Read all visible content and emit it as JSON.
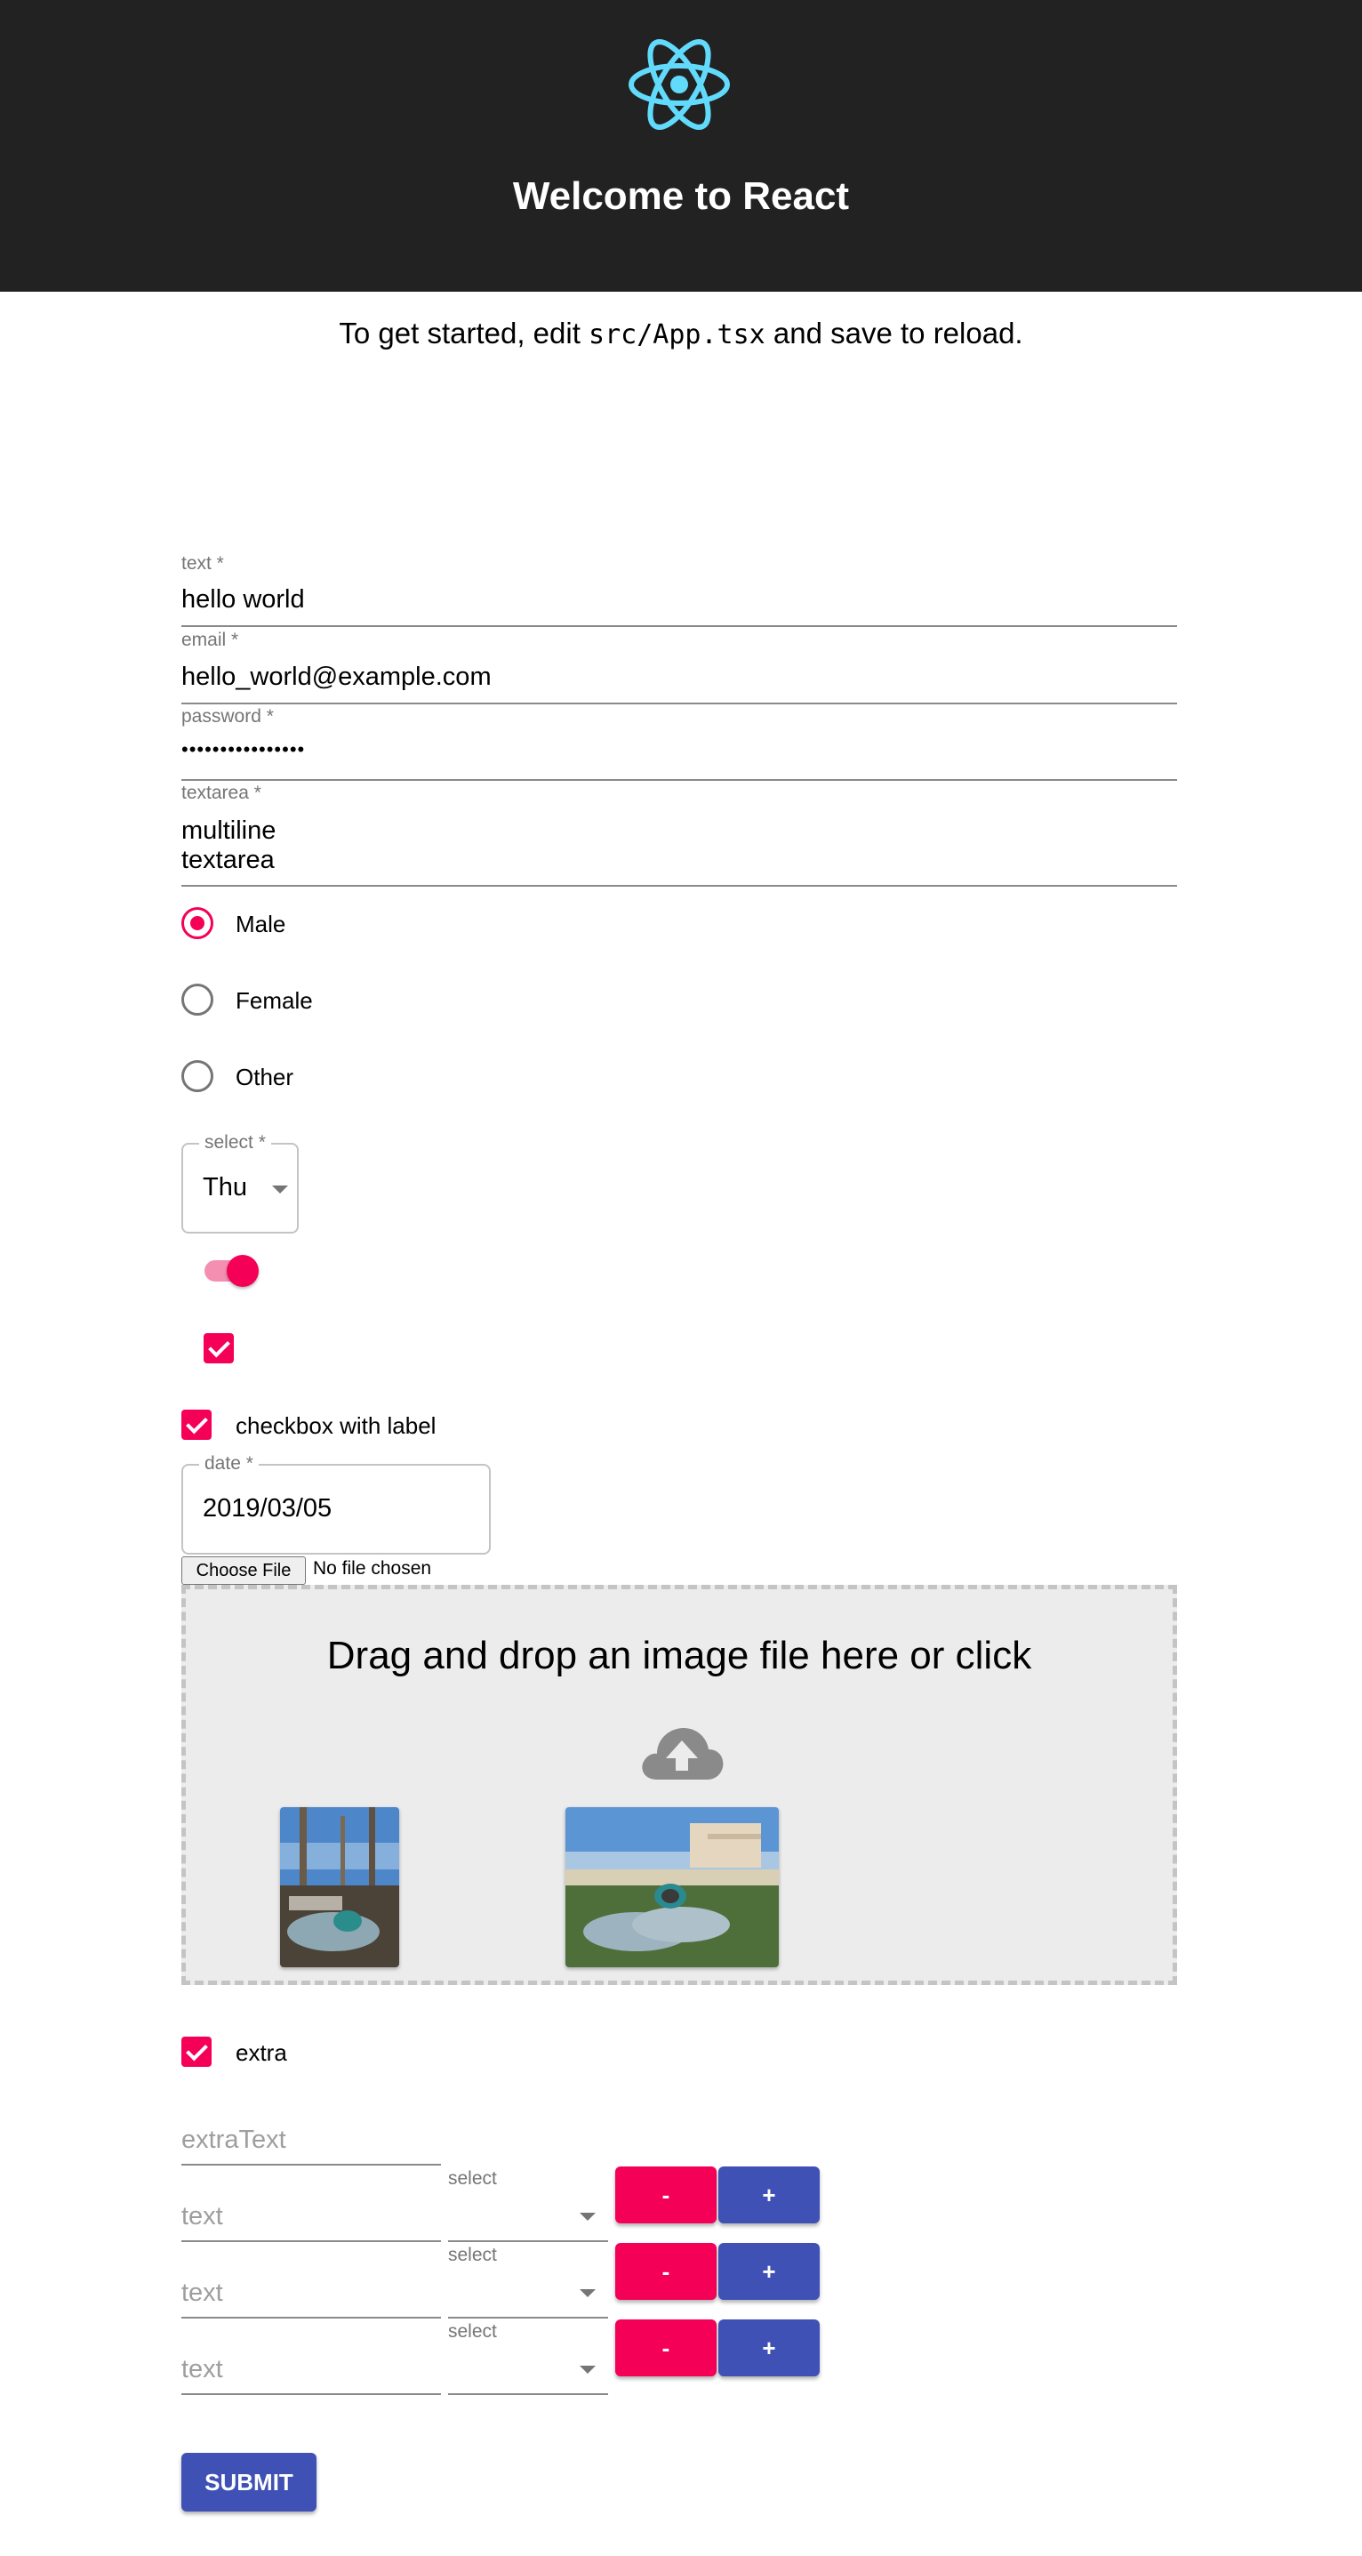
{
  "header": {
    "title": "Welcome to React",
    "logo_icon": "react-logo-icon",
    "background": "#222222",
    "logo_color": "#61dafb"
  },
  "intro": {
    "before": "To get started, edit ",
    "code": "src/App.tsx",
    "after": " and save to reload."
  },
  "form": {
    "text": {
      "label": "text *",
      "value": "hello world"
    },
    "email": {
      "label": "email *",
      "value": "hello_world@example.com"
    },
    "password": {
      "label": "password *",
      "value": "••••••••••••••••"
    },
    "textarea": {
      "label": "textarea *",
      "line1": "multiline",
      "line2": "textarea"
    },
    "gender": {
      "options": [
        "Male",
        "Female",
        "Other"
      ],
      "selected": "Male"
    },
    "select": {
      "label": "select *",
      "value": "Thu"
    },
    "switch": {
      "on": true
    },
    "checkbox": {
      "checked": true
    },
    "checkbox_with_label": {
      "label": "checkbox with label",
      "checked": true
    },
    "date": {
      "label": "date *",
      "value": "2019/03/05"
    },
    "file": {
      "button": "Choose File",
      "status": "No file chosen"
    },
    "dropzone": {
      "text": "Drag and drop an image file here or click",
      "icon": "cloud-upload-icon"
    },
    "extra": {
      "label": "extra",
      "checked": true
    },
    "extra_text": {
      "placeholder": "extraText"
    },
    "rows": [
      {
        "text_placeholder": "text",
        "select_label": "select",
        "minus": "-",
        "plus": "+"
      },
      {
        "text_placeholder": "text",
        "select_label": "select",
        "minus": "-",
        "plus": "+"
      },
      {
        "text_placeholder": "text",
        "select_label": "select",
        "minus": "-",
        "plus": "+"
      }
    ],
    "submit": "SUBMIT"
  },
  "colors": {
    "secondary": "#f50057",
    "primary": "#3f51b5"
  }
}
